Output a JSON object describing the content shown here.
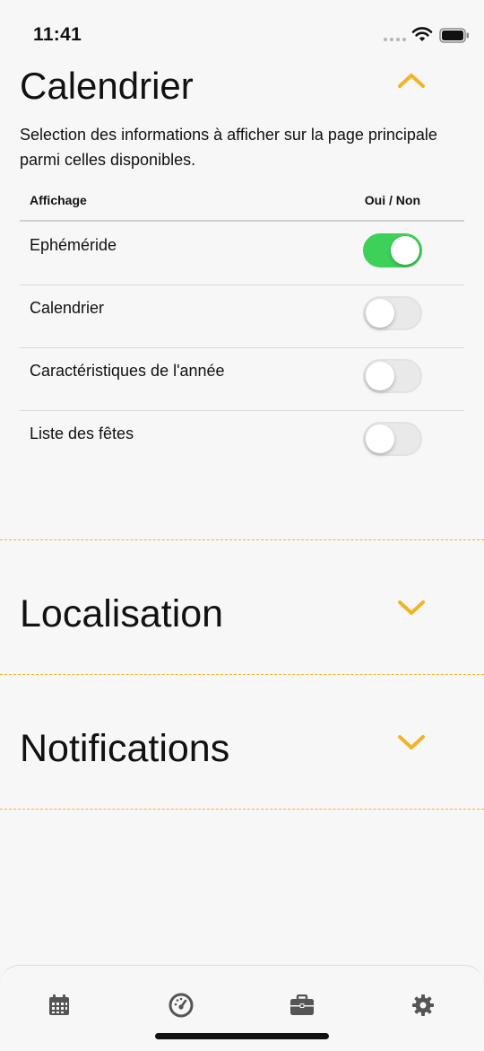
{
  "status_bar": {
    "time": "11:41"
  },
  "sections": {
    "calendrier": {
      "title": "Calendrier",
      "description": "Selection des informations à afficher sur la page principale parmi celles disponibles.",
      "table_header": {
        "left": "Affichage",
        "right": "Oui / Non"
      },
      "rows": [
        {
          "label": "Ephéméride",
          "enabled": true
        },
        {
          "label": "Calendrier",
          "enabled": false
        },
        {
          "label": "Caractéristiques de l'année",
          "enabled": false
        },
        {
          "label": "Liste des fêtes",
          "enabled": false
        }
      ]
    },
    "localisation": {
      "title": "Localisation"
    },
    "notifications": {
      "title": "Notifications"
    }
  },
  "colors": {
    "accent": "#f0b429",
    "toggle_on": "#3ed15a",
    "toggle_off": "#e9e9ea"
  },
  "tab_bar": {
    "items": [
      {
        "icon": "calendar-icon"
      },
      {
        "icon": "gauge-icon"
      },
      {
        "icon": "briefcase-icon"
      },
      {
        "icon": "gear-icon"
      }
    ]
  }
}
